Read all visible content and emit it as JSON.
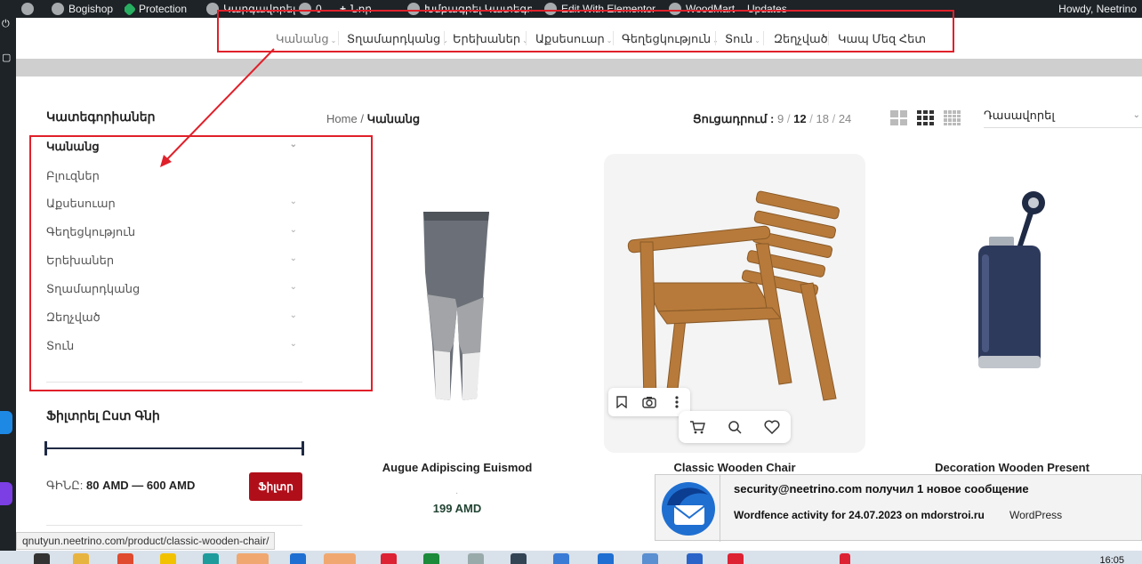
{
  "adminbar": {
    "site": "Bogishop",
    "protection": "Protection",
    "customize": "Կարգավորել",
    "comments_count": "0",
    "new": "Նոր",
    "edit_page": "Խմբագրել Կատեգորիա",
    "elementor": "Edit With Elementor",
    "woodmart": "WoodMart",
    "updates": "Updates",
    "howdy": "Howdy, Neetrino"
  },
  "nav": {
    "items": [
      "Կանանց",
      "Տղամարդկանց",
      "Երեխաներ",
      "Աքսեսուար",
      "Գեղեցկություն",
      "Տուն",
      "Զեղչված",
      "Կապ Մեզ Հետ"
    ]
  },
  "sidebar": {
    "title": "Կատեգորիաներ",
    "categories": [
      "Կանանց",
      "Բլուզներ",
      "Աքսեսուար",
      "Գեղեցկություն",
      "Երեխաներ",
      "Տղամարդկանց",
      "Զեղչված",
      "Տուն"
    ],
    "price_title": "Ֆիլտրել Ըստ Գնի",
    "price_label": "ԳԻՆԸ:",
    "price_range": "80 AMD — 600 AMD",
    "filter_button": "Ֆիլտր"
  },
  "toolbar": {
    "breadcrumb_home": "Home",
    "breadcrumb_sep": "/",
    "breadcrumb_current": "Կանանց",
    "show_label": "Ցուցադրում :",
    "show_options": [
      "9",
      "12",
      "18",
      "24"
    ],
    "show_selected": "12",
    "sort_label": "Դասավորել"
  },
  "products": [
    {
      "name": "Augue Adipiscing Euismod",
      "price": "199 AMD",
      "image": "leggings"
    },
    {
      "name": "Classic Wooden Chair",
      "price": "",
      "image": "wooden-chair"
    },
    {
      "name": "Decoration Wooden Present",
      "price": "",
      "image": "flask"
    }
  ],
  "notification": {
    "title": "security@neetrino.com получил 1 новое сообщение",
    "subject": "Wordfence activity for 24.07.2023 on mdorstroi.ru",
    "sender": "WordPress"
  },
  "status_url": "qnutyun.neetrino.com/product/classic-wooden-chair/",
  "clock": "16:05",
  "colors": {
    "accent_red": "#b00f1a",
    "annotation_red": "#e0202a",
    "adminbar": "#1d2327"
  }
}
